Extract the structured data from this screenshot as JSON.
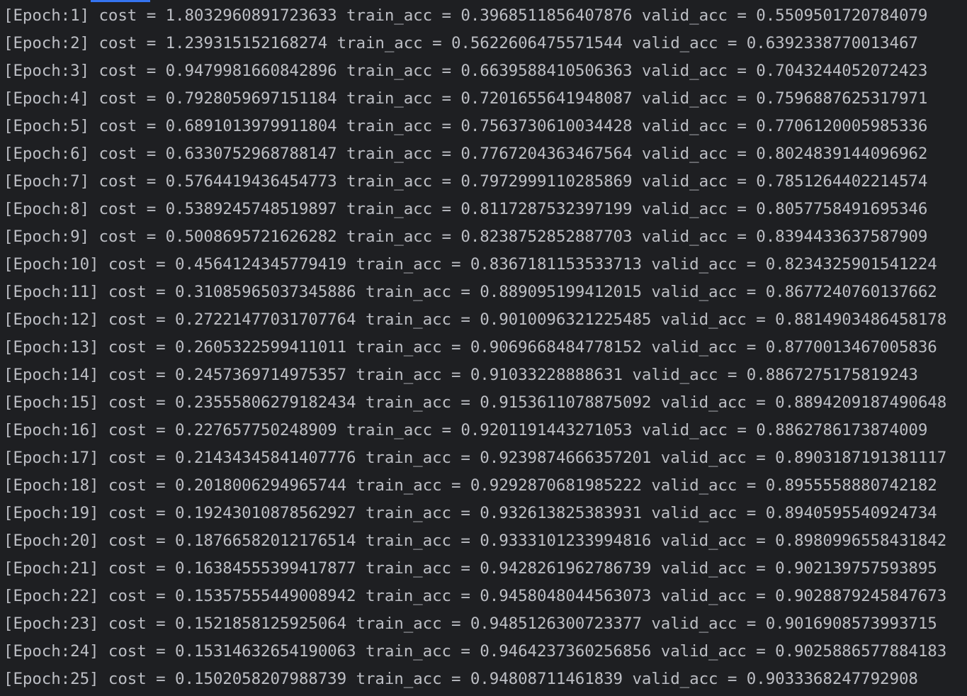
{
  "console": {
    "lines": [
      "[Epoch:1] cost = 1.8032960891723633 train_acc = 0.3968511856407876 valid_acc = 0.5509501720784079",
      "[Epoch:2] cost = 1.239315152168274 train_acc = 0.5622606475571544 valid_acc = 0.6392338770013467",
      "[Epoch:3] cost = 0.9479981660842896 train_acc = 0.6639588410506363 valid_acc = 0.7043244052072423",
      "[Epoch:4] cost = 0.7928059697151184 train_acc = 0.7201655641948087 valid_acc = 0.7596887625317971",
      "[Epoch:5] cost = 0.6891013979911804 train_acc = 0.7563730610034428 valid_acc = 0.7706120005985336",
      "[Epoch:6] cost = 0.6330752968788147 train_acc = 0.7767204363467564 valid_acc = 0.8024839144096962",
      "[Epoch:7] cost = 0.5764419436454773 train_acc = 0.7972999110285869 valid_acc = 0.7851264402214574",
      "[Epoch:8] cost = 0.5389245748519897 train_acc = 0.8117287532397199 valid_acc = 0.8057758491695346",
      "[Epoch:9] cost = 0.5008695721626282 train_acc = 0.8238752852887703 valid_acc = 0.8394433637587909",
      "[Epoch:10] cost = 0.456412434577941​9 train_acc = 0.8367181153533713 valid_acc = 0.8234325901541224",
      "[Epoch:11] cost = 0.31085965037345886 train_acc = 0.889095199412015 valid_acc = 0.8677240760137662",
      "[Epoch:12] cost = 0.27221477031707764 train_acc = 0.9010096321225485 valid_acc = 0.8814903486458178",
      "[Epoch:13] cost = 0.2605322599411011 train_acc = 0.9069668484778152 valid_acc = 0.8770013467005836",
      "[Epoch:14] cost = 0.2457369714975357 train_acc = 0.91033228888631 valid_acc = 0.8867275175819243",
      "[Epoch:15] cost = 0.23555806279182434 train_acc = 0.9153611078875092 valid_acc = 0.8894209187490648",
      "[Epoch:16] cost = 0.227657750248909 train_acc = 0.9201191443271053 valid_acc = 0.8862786173874009",
      "[Epoch:17] cost = 0.21434345841407776 train_acc = 0.9239874666357201 valid_acc = 0.8903187191381117",
      "[Epoch:18] cost = 0.2018006294965744 train_acc = 0.9292870681985222 valid_acc = 0.8955558880742182",
      "[Epoch:19] cost = 0.19243010878562927 train_acc = 0.932613825383931 valid_acc = 0.8940595540924734",
      "[Epoch:20] cost = 0.18766582012176514 train_acc = 0.9333101233994816 valid_acc = 0.8980996558431842",
      "[Epoch:21] cost = 0.16384555399417877 train_acc = 0.9428261962786739 valid_acc = 0.902139757593895",
      "[Epoch:22] cost = 0.15357555449008942 train_acc = 0.9458048044563073 valid_acc = 0.9028879245847673",
      "[Epoch:23] cost = 0.1521858125925064 train_acc = 0.9485126300723377 valid_acc = 0.9016908573993715",
      "[Epoch:24] cost = 0.15314632654190063 train_acc = 0.9464237360256856 valid_acc = 0.9025886577884183",
      "[Epoch:25] cost = 0.1502058207988739 train_acc = 0.94808711461839 valid_acc = 0.9033368247792908"
    ]
  }
}
